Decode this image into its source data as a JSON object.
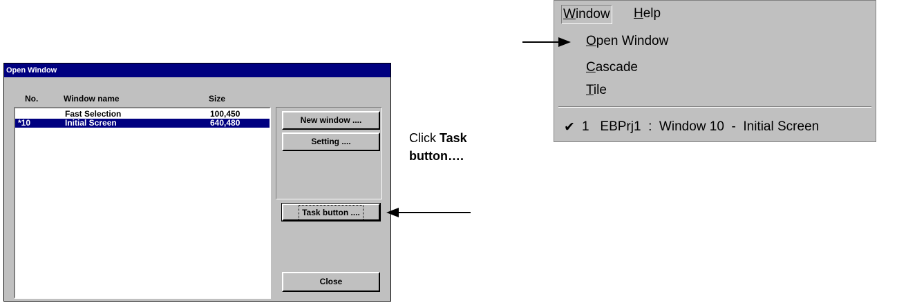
{
  "dialog": {
    "title": "Open Window",
    "columns": {
      "no": "No.",
      "name": "Window name",
      "size": "Size"
    },
    "rows": [
      {
        "no": "",
        "name": "Fast Selection",
        "size": "100,450",
        "selected": false
      },
      {
        "no": "*10",
        "name": "Initial Screen",
        "size": "640,480",
        "selected": true
      }
    ],
    "buttons": {
      "new_window": "New window ....",
      "setting": "Setting ....",
      "task_button": "Task button ....",
      "close": "Close"
    }
  },
  "callout": {
    "prefix": "Click ",
    "bold": "Task button…."
  },
  "menu": {
    "bar": {
      "window": "Window",
      "help": "Help"
    },
    "items": {
      "open_window": "Open Window",
      "cascade": "Cascade",
      "tile": "Tile",
      "window_entry": "1   EBPrj1  :  Window 10  -  Initial Screen"
    }
  }
}
